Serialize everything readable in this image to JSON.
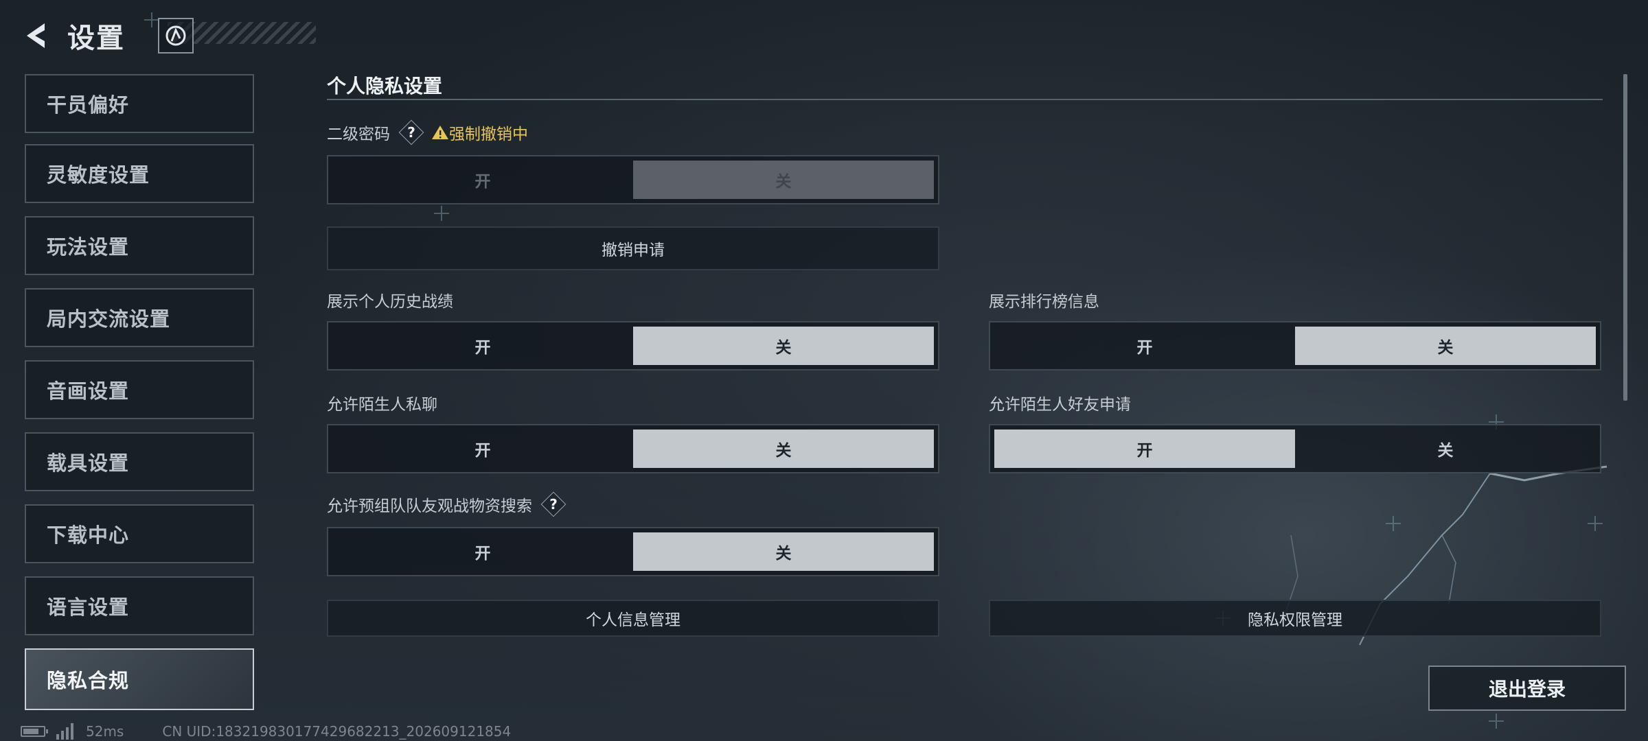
{
  "header": {
    "back_icon": "back-arrow-icon",
    "title": "设置",
    "logo_icon": "game-logo-icon"
  },
  "sidebar": {
    "items": [
      {
        "label": "干员偏好",
        "active": false
      },
      {
        "label": "灵敏度设置",
        "active": false
      },
      {
        "label": "玩法设置",
        "active": false
      },
      {
        "label": "局内交流设置",
        "active": false
      },
      {
        "label": "音画设置",
        "active": false
      },
      {
        "label": "载具设置",
        "active": false
      },
      {
        "label": "下载中心",
        "active": false
      },
      {
        "label": "语言设置",
        "active": false
      },
      {
        "label": "隐私合规",
        "active": true
      }
    ]
  },
  "main": {
    "section_title": "个人隐私设置",
    "secondary_password": {
      "label": "二级密码",
      "help": "?",
      "warning": "强制撤销中",
      "on": "开",
      "off": "关",
      "selected": "off",
      "disabled": true,
      "revoke_button": "撤销申请"
    },
    "history_record": {
      "label": "展示个人历史战绩",
      "on": "开",
      "off": "关",
      "selected": "off"
    },
    "leaderboard_info": {
      "label": "展示排行榜信息",
      "on": "开",
      "off": "关",
      "selected": "off"
    },
    "stranger_chat": {
      "label": "允许陌生人私聊",
      "on": "开",
      "off": "关",
      "selected": "off"
    },
    "stranger_friend_request": {
      "label": "允许陌生人好友申请",
      "on": "开",
      "off": "关",
      "selected": "on"
    },
    "squad_search": {
      "label": "允许预组队队友观战物资搜索",
      "help": "?",
      "on": "开",
      "off": "关",
      "selected": "off"
    },
    "personal_info_button": "个人信息管理",
    "privacy_permission_button": "隐私权限管理",
    "logout_button": "退出登录"
  },
  "status_bar": {
    "battery_level": 0.7,
    "ping": "52ms",
    "uid": "CN UID:18321983017742968​2213_202609121854"
  },
  "colors": {
    "selected_toggle": "#c3c8cc",
    "warning": "#e6c45a",
    "active_border": "#c9cfd4"
  }
}
